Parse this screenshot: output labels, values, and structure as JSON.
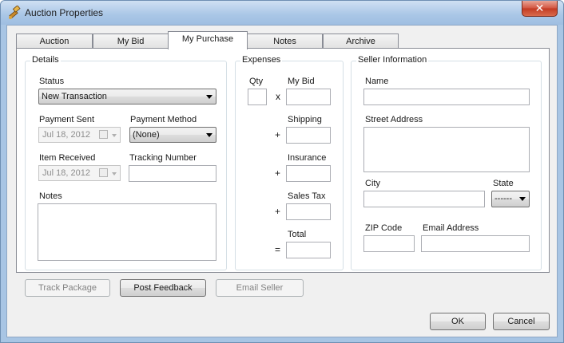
{
  "window": {
    "title": "Auction Properties",
    "close_label": "✕"
  },
  "tabs": [
    {
      "label": "Auction"
    },
    {
      "label": "My Bid"
    },
    {
      "label": "My Purchase",
      "active": true
    },
    {
      "label": "Notes"
    },
    {
      "label": "Archive"
    }
  ],
  "details": {
    "legend": "Details",
    "status_label": "Status",
    "status_value": "New Transaction",
    "payment_sent_label": "Payment Sent",
    "payment_sent_date": "Jul  18, 2012",
    "payment_method_label": "Payment Method",
    "payment_method_value": "(None)",
    "item_received_label": "Item Received",
    "item_received_date": "Jul  18, 2012",
    "tracking_number_label": "Tracking Number",
    "tracking_number_value": "",
    "notes_label": "Notes",
    "notes_value": ""
  },
  "expenses": {
    "legend": "Expenses",
    "qty_label": "Qty",
    "my_bid_label": "My Bid",
    "times_symbol": "x",
    "shipping_label": "Shipping",
    "insurance_label": "Insurance",
    "sales_tax_label": "Sales Tax",
    "total_label": "Total",
    "plus_symbol": "+",
    "equals_symbol": "="
  },
  "seller": {
    "legend": "Seller Information",
    "name_label": "Name",
    "street_label": "Street Address",
    "city_label": "City",
    "state_label": "State",
    "state_value": "------",
    "zip_label": "ZIP Code",
    "email_label": "Email Address"
  },
  "actions": {
    "track_package": "Track Package",
    "post_feedback": "Post Feedback",
    "email_seller": "Email Seller"
  },
  "footer": {
    "ok": "OK",
    "cancel": "Cancel"
  }
}
